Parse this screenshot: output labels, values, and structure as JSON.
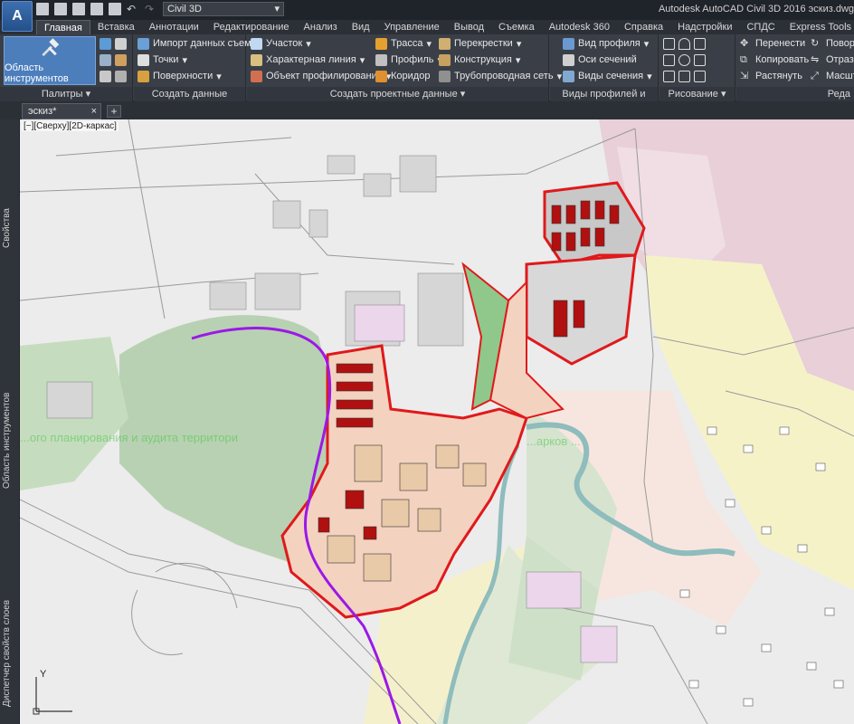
{
  "app": {
    "logo_letter": "A",
    "logo_sub": "CIV",
    "workspace": "Civil 3D",
    "title": "Autodesk AutoCAD Civil 3D 2016    эскиз.dwg"
  },
  "tabs": [
    "Главная",
    "Вставка",
    "Аннотации",
    "Редактирование",
    "Анализ",
    "Вид",
    "Управление",
    "Вывод",
    "Съемка",
    "Autodesk 360",
    "Справка",
    "Надстройки",
    "СПДС",
    "Express Tools"
  ],
  "ribbon": {
    "toolspace_label": "Область инструментов",
    "panels": {
      "palettes": "Палитры",
      "ground": "Создать данные рельефа",
      "design": "Создать проектные данные",
      "profiles": "Виды профилей и сечений",
      "draw": "Рисование",
      "modify": "Реда"
    },
    "ground_items": [
      "Импорт данных съемки",
      "Точки",
      "Поверхности"
    ],
    "design_col1": [
      "Участок",
      "Характерная линия",
      "Объект профилирования"
    ],
    "design_col2": [
      "Трасса",
      "Профиль",
      "Коридор"
    ],
    "design_col3": [
      "Перекрестки",
      "Конструкция",
      "Трубопроводная сеть"
    ],
    "profile_items": [
      "Вид профиля",
      "Оси сечений",
      "Виды сечения"
    ],
    "modify_col1": [
      "Перенести",
      "Копировать",
      "Растянуть"
    ],
    "modify_col2": [
      "Поворот",
      "Отразить",
      "Масштаб"
    ]
  },
  "doc": {
    "tab": "эскиз*",
    "plus": "+"
  },
  "side_labels": [
    "Свойства",
    "Область инструментов",
    "Диспетчер свойств слоев"
  ],
  "viewport": {
    "label": "[−][Сверху][2D-каркас]",
    "watermark_left": "...ого планирования и аудита территори",
    "watermark_right": "...арков ...",
    "ucs_y": "Y"
  },
  "colors": {
    "accent": "#4d7ebc",
    "boundary": "#e0191b",
    "rail": "#9b19e6",
    "forest": "#a8c7a0"
  }
}
